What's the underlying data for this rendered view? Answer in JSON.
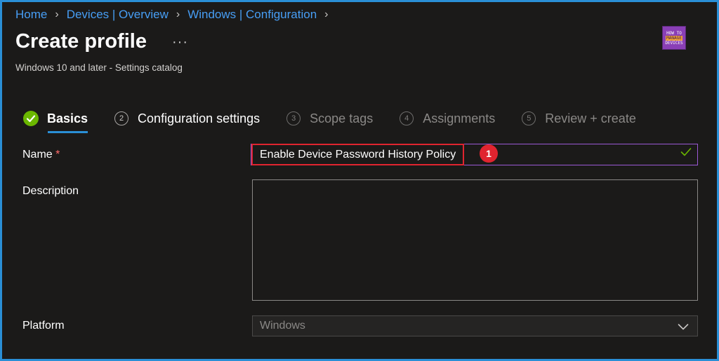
{
  "breadcrumb": {
    "items": [
      "Home",
      "Devices | Overview",
      "Windows | Configuration"
    ]
  },
  "header": {
    "title": "Create profile",
    "more_label": "···",
    "subtitle": "Windows 10 and later - Settings catalog",
    "logo": {
      "line1": "HOW TO",
      "line2": "MANAGE",
      "line3": "DEVICES"
    }
  },
  "wizard": {
    "steps": [
      {
        "number": "",
        "label": "Basics",
        "state": "done"
      },
      {
        "number": "2",
        "label": "Configuration settings",
        "state": "current"
      },
      {
        "number": "3",
        "label": "Scope tags",
        "state": "inactive"
      },
      {
        "number": "4",
        "label": "Assignments",
        "state": "inactive"
      },
      {
        "number": "5",
        "label": "Review + create",
        "state": "inactive"
      }
    ]
  },
  "form": {
    "name_label": "Name",
    "required_mark": "*",
    "name_value": "Enable Device Password History Policy",
    "annotation_number": "1",
    "description_label": "Description",
    "description_value": "",
    "platform_label": "Platform",
    "platform_value": "Windows"
  },
  "colors": {
    "accent": "#2a8fd6",
    "success": "#6bb700",
    "highlight": "#e0242f",
    "focus_border": "#9b59d6"
  }
}
